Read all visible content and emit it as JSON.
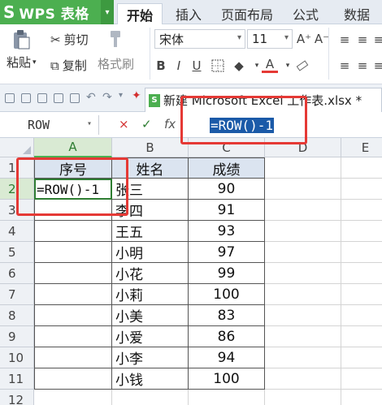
{
  "app": {
    "logo_glyph": "S",
    "name": "WPS 表格",
    "menu_arrow": "▾"
  },
  "tabs": [
    {
      "label": "开始",
      "active": true
    },
    {
      "label": "插入",
      "active": false
    },
    {
      "label": "页面布局",
      "active": false
    },
    {
      "label": "公式",
      "active": false
    },
    {
      "label": "数据",
      "active": false
    }
  ],
  "ribbon": {
    "paste_label": "粘贴",
    "cut_label": "剪切",
    "copy_label": "复制",
    "format_painter_label": "格式刷",
    "font_name": "宋体",
    "font_size": "11",
    "bold": "B",
    "italic": "I",
    "underline": "U",
    "grow_font": "A⁺",
    "shrink_font": "A⁻",
    "font_color": "A",
    "fill_color": "◆"
  },
  "document_tab": {
    "title": "新建 Microsoft Excel 工作表.xlsx *"
  },
  "formula_bar": {
    "name_box": "ROW",
    "cancel": "×",
    "confirm": "✓",
    "fx": "fx",
    "formula": "=ROW()-1"
  },
  "grid": {
    "columns": [
      "A",
      "B",
      "C",
      "D",
      "E"
    ],
    "rows": [
      "1",
      "2",
      "3",
      "4",
      "5",
      "6",
      "7",
      "8",
      "9",
      "10",
      "11",
      "12"
    ],
    "header_row": [
      "序号",
      "姓名",
      "成绩"
    ],
    "editing_cell": "=ROW()-1",
    "names": [
      "张三",
      "李四",
      "王五",
      "小明",
      "小花",
      "小莉",
      "小美",
      "小爱",
      "小李",
      "小钱"
    ],
    "scores": [
      "90",
      "91",
      "93",
      "97",
      "99",
      "100",
      "83",
      "86",
      "94",
      "100"
    ]
  },
  "colors": {
    "accent_green": "#4caf50",
    "annotation_red": "#e53935",
    "selection_blue": "#1b5aa8"
  }
}
